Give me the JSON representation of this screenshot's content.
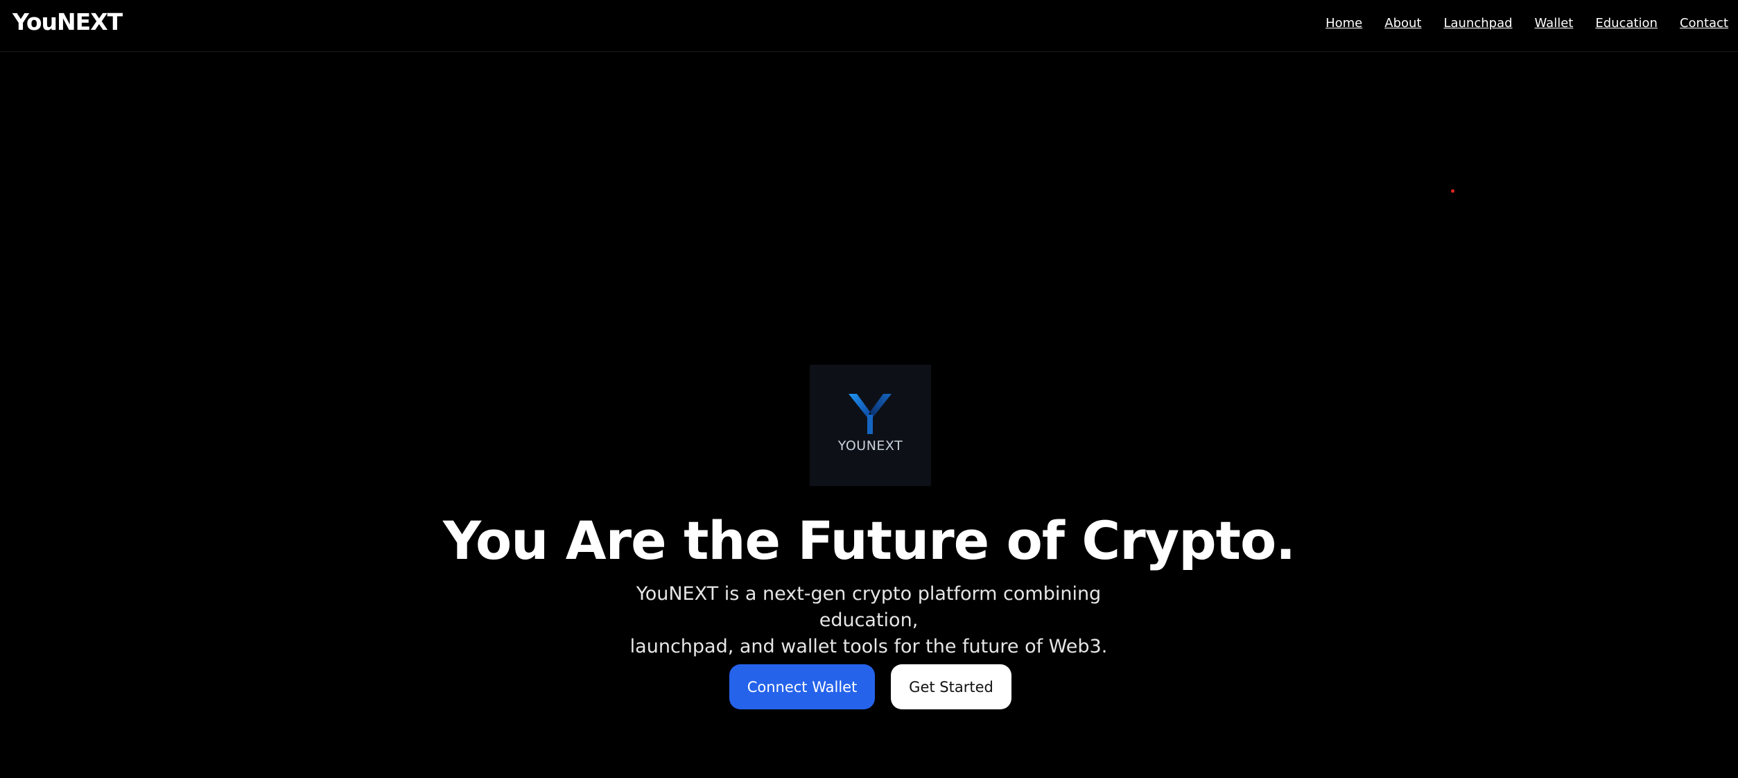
{
  "header": {
    "brand": "YouNEXT",
    "nav": [
      {
        "label": "Home"
      },
      {
        "label": "About"
      },
      {
        "label": "Launchpad"
      },
      {
        "label": "Wallet"
      },
      {
        "label": "Education"
      },
      {
        "label": "Contact"
      }
    ]
  },
  "hero": {
    "logo": {
      "icon": "y-mark-icon",
      "wordmark": "YOUNEXT"
    },
    "title": "You Are the Future of Crypto.",
    "subtitle_line1": "YouNEXT is a next-gen crypto platform combining education,",
    "subtitle_line2": "launchpad, and wallet tools for the future of Web3.",
    "primary_button": "Connect Wallet",
    "secondary_button": "Get Started"
  },
  "colors": {
    "background": "#000000",
    "primary_button": "#2563eb",
    "logo_tile": "#0d1117",
    "logo_blue": "#1e88e5",
    "accent_dot": "#e0261b"
  }
}
